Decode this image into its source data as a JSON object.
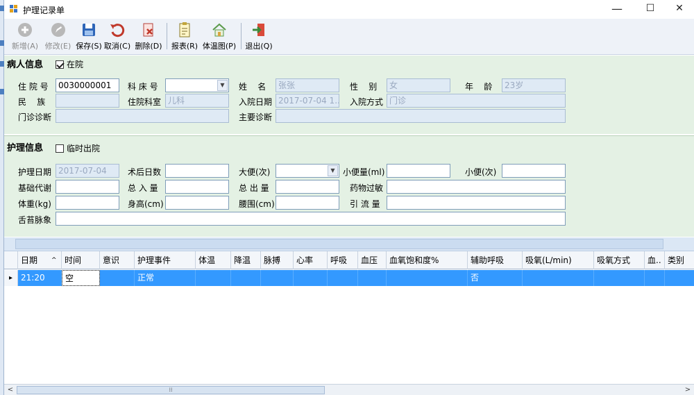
{
  "window": {
    "title": "护理记录单",
    "minimize": "—",
    "maximize": "☐",
    "close": "✕"
  },
  "toolbar": [
    {
      "label": "新增(A)",
      "icon": "add-icon",
      "enabled": false
    },
    {
      "label": "修改(E)",
      "icon": "edit-icon",
      "enabled": false
    },
    {
      "label": "保存(S)",
      "icon": "save-icon",
      "enabled": true
    },
    {
      "label": "取消(C)",
      "icon": "undo-icon",
      "enabled": true
    },
    {
      "label": "删除(D)",
      "icon": "delete-icon",
      "enabled": true
    },
    {
      "label": "报表(R)",
      "icon": "report-icon",
      "enabled": true
    },
    {
      "label": "体温图(P)",
      "icon": "home-icon",
      "enabled": true
    },
    {
      "label": "退出(Q)",
      "icon": "exit-icon",
      "enabled": true
    }
  ],
  "patient": {
    "title": "病人信息",
    "in_hospital": {
      "label": "在院",
      "checked": true
    },
    "fields": {
      "admission_no": {
        "label": "住 院 号",
        "value": "0030000001"
      },
      "bed_no": {
        "label": "科 床 号",
        "value": ""
      },
      "name": {
        "label": "姓    名",
        "value": "张张"
      },
      "gender": {
        "label": "性    别",
        "value": "女"
      },
      "age": {
        "label": "年    龄",
        "value": "23岁"
      },
      "ethnicity": {
        "label": "民    族",
        "value": ""
      },
      "department": {
        "label": "住院科室",
        "value": "儿科"
      },
      "admit_date": {
        "label": "入院日期",
        "value": "2017-07-04 1..."
      },
      "admit_way": {
        "label": "入院方式",
        "value": "门诊"
      },
      "outpatient_diag": {
        "label": "门诊诊断",
        "value": ""
      },
      "main_diag": {
        "label": "主要诊断",
        "value": ""
      }
    }
  },
  "nursing": {
    "title": "护理信息",
    "temp_leave": {
      "label": "临时出院",
      "checked": false
    },
    "fields": {
      "care_date": {
        "label": "护理日期",
        "value": "2017-07-04"
      },
      "post_op_days": {
        "label": "术后日数",
        "value": ""
      },
      "stool": {
        "label": "大便(次)",
        "value": ""
      },
      "urine_ml": {
        "label": "小便量(ml)",
        "value": ""
      },
      "urine_times": {
        "label": "小便(次)",
        "value": ""
      },
      "basal_metab": {
        "label": "基础代谢",
        "value": ""
      },
      "total_in": {
        "label": "总 入 量",
        "value": ""
      },
      "total_out": {
        "label": "总 出 量",
        "value": ""
      },
      "drug_allergy": {
        "label": "药物过敏",
        "value": ""
      },
      "weight": {
        "label": "体重(kg)",
        "value": ""
      },
      "height": {
        "label": "身高(cm)",
        "value": ""
      },
      "waist": {
        "label": "腰围(cm)",
        "value": ""
      },
      "drainage": {
        "label": "引 流 量",
        "value": ""
      },
      "tongue_pulse": {
        "label": "舌苔脉象",
        "value": ""
      }
    }
  },
  "grid": {
    "columns": [
      "日期",
      "时间",
      "意识",
      "护理事件",
      "体温",
      "降温",
      "脉搏",
      "心率",
      "呼吸",
      "血压",
      "血氧饱和度%",
      "辅助呼吸",
      "吸氧(L/min)",
      "吸氧方式",
      "血..",
      "类别"
    ],
    "sort_indicator": "^",
    "rows": [
      [
        "21:20",
        "空",
        "",
        "正常",
        "",
        "",
        "",
        "",
        "",
        "",
        "",
        "否",
        "",
        "",
        "",
        ""
      ]
    ],
    "row_marker": "▸"
  },
  "scroll": {
    "left": "<",
    "right": ">",
    "grip": "⁞⁞"
  }
}
